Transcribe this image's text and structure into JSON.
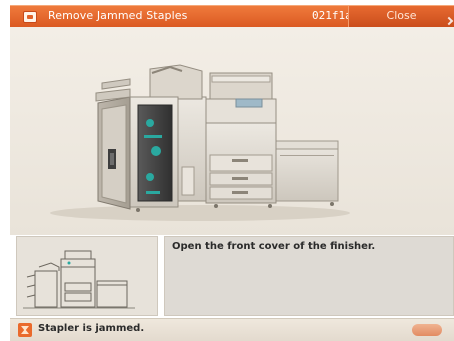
{
  "titlebar": {
    "title": "Remove Jammed Staples",
    "code": "021f1a",
    "close_label": "Close"
  },
  "main": {
    "illustration": "finisher-front-cover-open"
  },
  "instruction": {
    "text": "Open the front cover of the finisher."
  },
  "status": {
    "text": "Stapler is jammed."
  },
  "icons": {
    "title": "staple-jam-icon",
    "status": "stapler-warning-icon"
  },
  "colors": {
    "accent": "#e26428",
    "background": "#efe9e0",
    "highlight": "#2aa9a0"
  }
}
